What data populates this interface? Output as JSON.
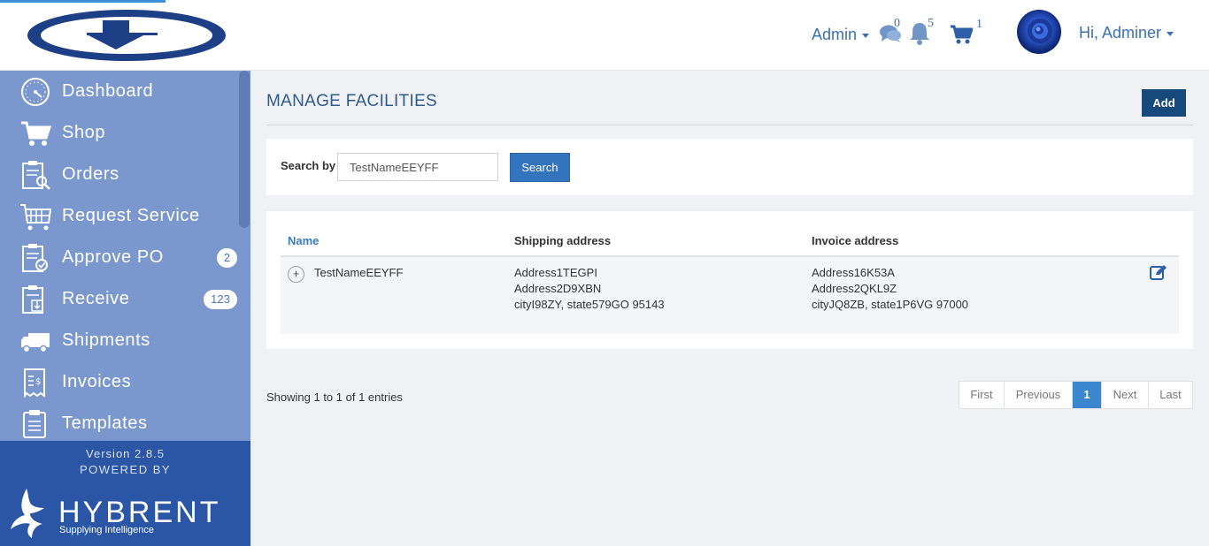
{
  "header": {
    "admin_menu": "Admin",
    "messages_count": "0",
    "notifications_count": "5",
    "cart_count": "1",
    "user_greeting": "Hi, Adminer"
  },
  "sidebar": {
    "items": [
      {
        "label": "Dashboard",
        "icon": "dashboard-icon"
      },
      {
        "label": "Shop",
        "icon": "cart-icon"
      },
      {
        "label": "Orders",
        "icon": "orders-icon"
      },
      {
        "label": "Request Service",
        "icon": "request-service-icon"
      },
      {
        "label": "Approve PO",
        "icon": "approve-po-icon",
        "badge": "2"
      },
      {
        "label": "Receive",
        "icon": "receive-icon",
        "badge": "123"
      },
      {
        "label": "Shipments",
        "icon": "truck-icon"
      },
      {
        "label": "Invoices",
        "icon": "invoice-icon"
      },
      {
        "label": "Templates",
        "icon": "templates-icon"
      }
    ],
    "version": "Version 2.8.5",
    "powered_by": "POWERED BY",
    "brand": "HYBRENT",
    "tagline": "Supplying Intelligence"
  },
  "main": {
    "title": "MANAGE FACILITIES",
    "add_label": "Add",
    "search": {
      "label": "Search by",
      "value": "TestNameEEYFF",
      "button": "Search"
    },
    "table": {
      "columns": [
        "Name",
        "Shipping address",
        "Invoice address"
      ],
      "rows": [
        {
          "name": "TestNameEEYFF",
          "shipping": [
            "Address1TEGPI",
            "Address2D9XBN",
            "cityI98ZY, state579GO 95143"
          ],
          "invoice": [
            "Address16K53A",
            "Address2QKL9Z",
            "cityJQ8ZB, state1P6VG 97000"
          ]
        }
      ]
    },
    "showing": "Showing 1 to 1 of 1 entries",
    "pagination": {
      "first": "First",
      "previous": "Previous",
      "current": "1",
      "next": "Next",
      "last": "Last"
    }
  },
  "colors": {
    "sidebar": "#7a98cd",
    "sidebar_footer": "#2b56a6",
    "accent": "#3374bf",
    "add_button": "#17497c",
    "active_page": "#3a86cf"
  }
}
